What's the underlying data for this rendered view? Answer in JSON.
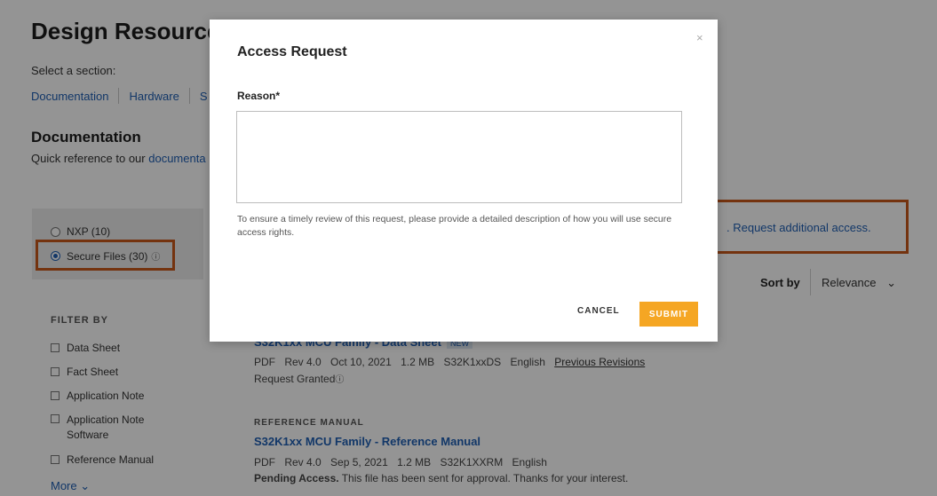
{
  "page": {
    "title": "Design Resources",
    "select_label": "Select a section:",
    "nav": [
      "Documentation",
      "Hardware",
      "S"
    ],
    "doc_heading": "Documentation",
    "quick_ref_prefix": "Quick reference to our ",
    "quick_ref_link": "documenta"
  },
  "filter_panel": {
    "options": [
      {
        "label": "NXP (10)",
        "selected": false
      },
      {
        "label": "Secure Files (30)",
        "selected": true,
        "info_icon": "info-icon"
      }
    ]
  },
  "access": {
    "text": ". Request additional access."
  },
  "sort": {
    "label": "Sort by",
    "value": "Relevance",
    "chevron": "⌄"
  },
  "filter_by": {
    "heading": "FILTER BY",
    "items": [
      "Data Sheet",
      "Fact Sheet",
      "Application Note",
      "Application Note Software",
      "Reference Manual"
    ],
    "more": "More ⌄"
  },
  "results": [
    {
      "title": "S32K1xx MCU Family - Data Sheet",
      "badge": "NEW",
      "meta": [
        "PDF",
        "Rev 4.0",
        "Oct 10, 2021",
        "1.2 MB",
        "S32K1xxDS",
        "English"
      ],
      "meta_link": "Previous Revisions",
      "status": "Request Granted"
    },
    {
      "category": "REFERENCE MANUAL",
      "title": "S32K1xx MCU Family - Reference Manual",
      "meta": [
        "PDF",
        "Rev 4.0",
        "Sep 5, 2021",
        "1.2 MB",
        "S32K1XXRM",
        "English"
      ],
      "status_bold": "Pending Access.",
      "status_rest": " This file has been sent for approval. Thanks for your interest."
    }
  ],
  "modal": {
    "title": "Access Request",
    "close": "×",
    "reason_label": "Reason*",
    "reason_value": "",
    "help": "To ensure a timely review of this request, please provide a detailed description of how you will use secure access rights.",
    "cancel": "CANCEL",
    "submit": "SUBMIT"
  },
  "colors": {
    "accent": "#1f5fb4",
    "submit": "#f5a623",
    "highlight_box": "#c8591a"
  }
}
